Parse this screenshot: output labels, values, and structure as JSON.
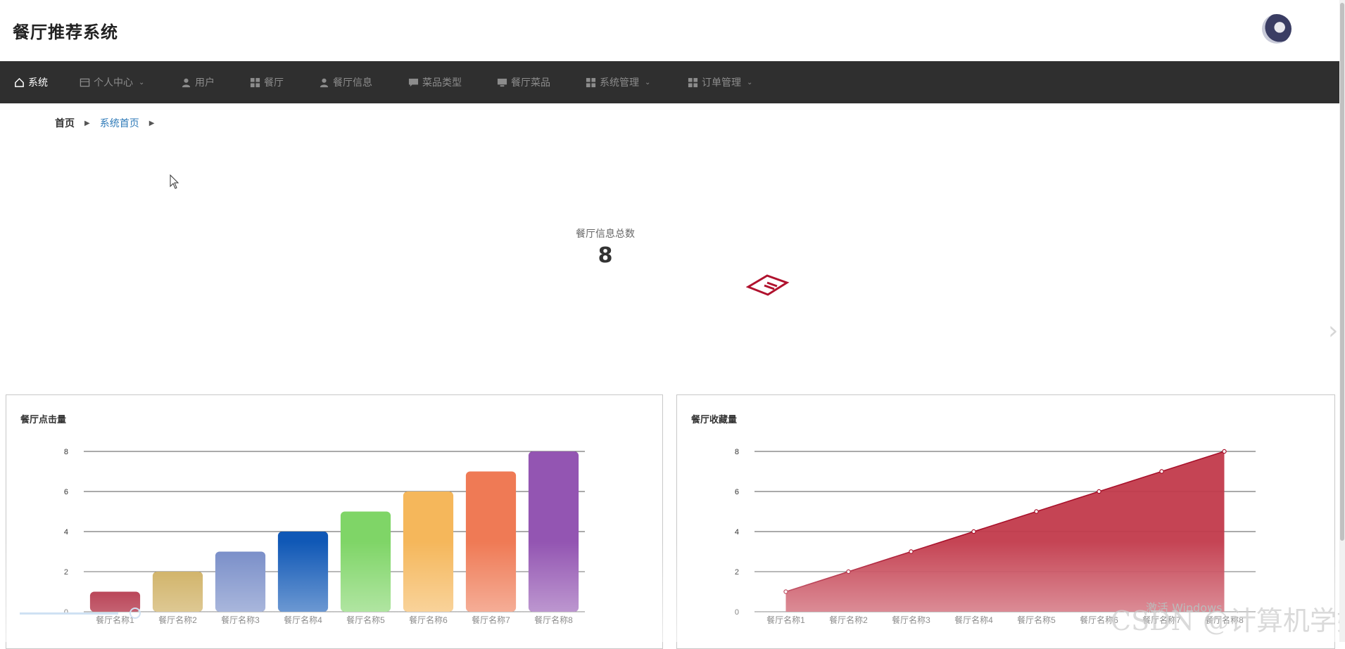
{
  "header": {
    "app_title": "餐厅推荐系统"
  },
  "nav": [
    {
      "label": "系统",
      "icon": "home-icon",
      "active": true,
      "dropdown": false
    },
    {
      "label": "个人中心",
      "icon": "card-icon",
      "active": false,
      "dropdown": true
    },
    {
      "label": "用户",
      "icon": "user-icon",
      "active": false,
      "dropdown": false
    },
    {
      "label": "餐厅",
      "icon": "grid-icon",
      "active": false,
      "dropdown": false
    },
    {
      "label": "餐厅信息",
      "icon": "user-icon",
      "active": false,
      "dropdown": false
    },
    {
      "label": "菜品类型",
      "icon": "chat-icon",
      "active": false,
      "dropdown": false
    },
    {
      "label": "餐厅菜品",
      "icon": "monitor-icon",
      "active": false,
      "dropdown": false
    },
    {
      "label": "系统管理",
      "icon": "grid-icon",
      "active": false,
      "dropdown": true
    },
    {
      "label": "订单管理",
      "icon": "grid-icon",
      "active": false,
      "dropdown": true
    }
  ],
  "breadcrumb": {
    "home": "首页",
    "current": "系统首页"
  },
  "stat": {
    "label": "餐厅信息总数",
    "value": "8",
    "icon": "ticket-icon",
    "icon_color": "#b0122e"
  },
  "watermark": {
    "activate": "激活 Windows",
    "csdn": "CSDN @计算机学姐"
  },
  "chart_data": [
    {
      "type": "bar",
      "title": "餐厅点击量",
      "categories": [
        "餐厅名称1",
        "餐厅名称2",
        "餐厅名称3",
        "餐厅名称4",
        "餐厅名称5",
        "餐厅名称6",
        "餐厅名称7",
        "餐厅名称8"
      ],
      "values": [
        1,
        2,
        3,
        4,
        5,
        6,
        7,
        8
      ],
      "colors": [
        "#a0001a",
        "#c9a64f",
        "#7389c6",
        "#1058b6",
        "#7fd567",
        "#f5b75b",
        "#ef7a55",
        "#9355b2"
      ],
      "yticks": [
        0,
        2,
        4,
        6,
        8
      ],
      "ylim": [
        0,
        8
      ],
      "grid": true
    },
    {
      "type": "area",
      "title": "餐厅收藏量",
      "categories": [
        "餐厅名称1",
        "餐厅名称2",
        "餐厅名称3",
        "餐厅名称4",
        "餐厅名称5",
        "餐厅名称6",
        "餐厅名称7",
        "餐厅名称8"
      ],
      "values": [
        1,
        2,
        3,
        4,
        5,
        6,
        7,
        8
      ],
      "color": "#c23a4b",
      "yticks": [
        0,
        2,
        4,
        6,
        8
      ],
      "ylim": [
        0,
        8
      ],
      "grid": true
    }
  ]
}
